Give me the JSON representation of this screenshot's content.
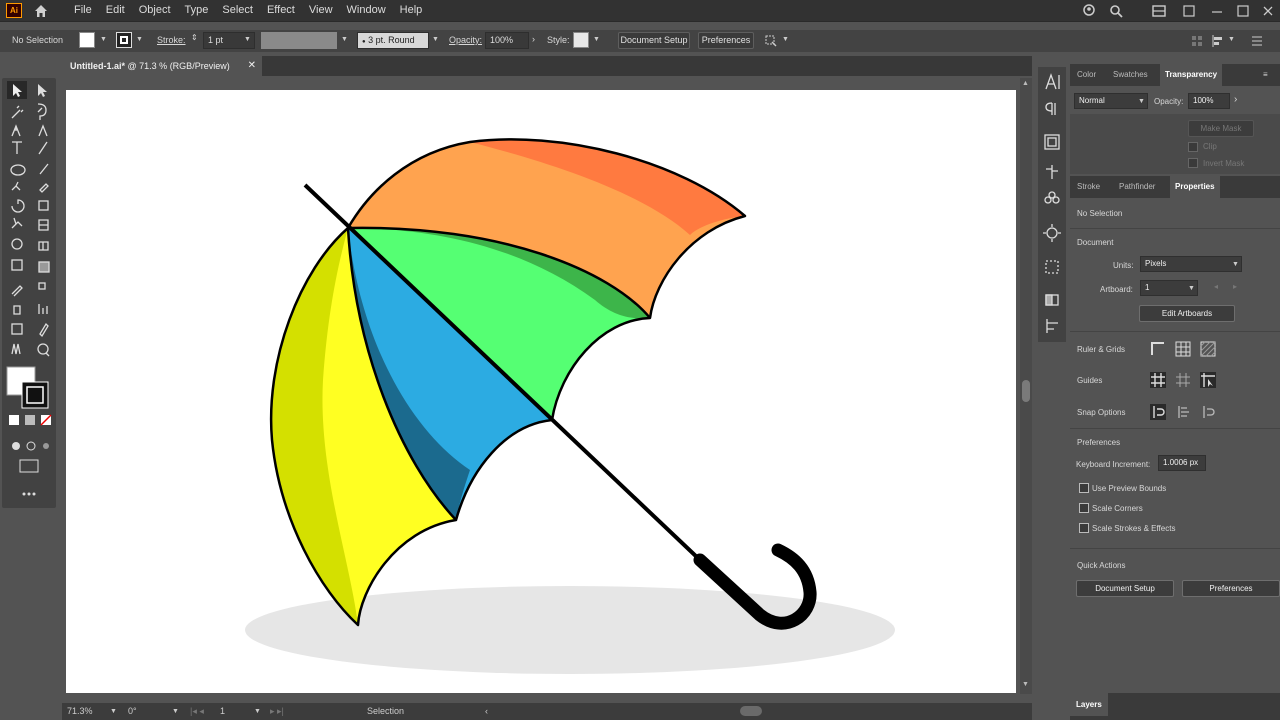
{
  "app": {
    "logo": "Ai"
  },
  "menu": [
    "File",
    "Edit",
    "Object",
    "Type",
    "Select",
    "Effect",
    "View",
    "Window",
    "Help"
  ],
  "control_bar": {
    "selection": "No Selection",
    "stroke_label": "Stroke:",
    "stroke_weight": "1 pt",
    "brush": "3 pt. Round",
    "opacity_label": "Opacity:",
    "opacity": "100%",
    "style_label": "Style:",
    "doc_setup": "Document Setup",
    "preferences": "Preferences"
  },
  "document_tab": {
    "name": "Untitled-1.ai*",
    "info": "@ 71.3 % (RGB/Preview)"
  },
  "status": {
    "zoom": "71.3%",
    "rotation": "0°",
    "artboard": "1",
    "tool": "Selection"
  },
  "panels": {
    "top_tabs": [
      "Color",
      "Swatches",
      "Transparency"
    ],
    "blend_mode": "Normal",
    "opacity_label": "Opacity:",
    "opacity": "100%",
    "make_mask": "Make Mask",
    "clip": "Clip",
    "invert_mask": "Invert Mask",
    "mid_tabs": [
      "Stroke",
      "Pathfinder",
      "Properties"
    ],
    "no_selection": "No Selection",
    "document": "Document",
    "units_label": "Units:",
    "units": "Pixels",
    "artboard_label": "Artboard:",
    "artboard": "1",
    "edit_artboards": "Edit Artboards",
    "rulers_grids": "Ruler & Grids",
    "guides": "Guides",
    "snap_options": "Snap Options",
    "preferences_heading": "Preferences",
    "keyboard_increment_label": "Keyboard Increment:",
    "keyboard_increment": "1.0006 px",
    "use_preview_bounds": "Use Preview Bounds",
    "scale_corners": "Scale Corners",
    "scale_strokes": "Scale Strokes & Effects",
    "quick_actions": "Quick Actions",
    "doc_setup_btn": "Document Setup",
    "prefs_btn": "Preferences",
    "layers": "Layers"
  },
  "colors": {
    "umbrella_orange_dark": "#FF7A40",
    "umbrella_orange_light": "#FFA34F",
    "umbrella_green_dark": "#3DB54A",
    "umbrella_green_light": "#55FF73",
    "umbrella_blue_dark": "#1B6A8E",
    "umbrella_blue_light": "#2CABE2",
    "umbrella_yellow_dark": "#D4E000",
    "umbrella_yellow_light": "#FFFF22",
    "shadow": "#E6E6E6"
  }
}
